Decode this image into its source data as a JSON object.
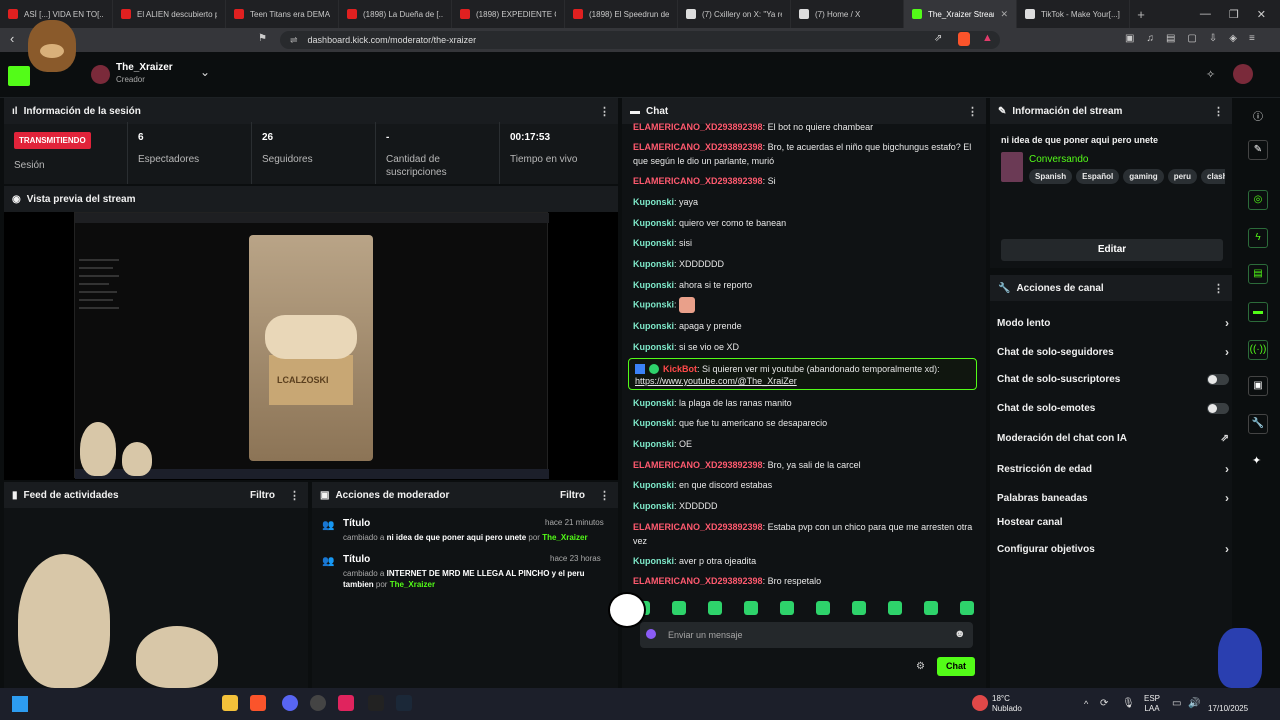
{
  "browser": {
    "tabs": [
      {
        "label": "ASÍ [...] VIDA EN TO[...]",
        "color": "#e02020"
      },
      {
        "label": "El ALIEN descubierto p[...]",
        "color": "#e02020"
      },
      {
        "label": "Teen Titans era DEMAS[...]",
        "color": "#e02020"
      },
      {
        "label": "(1898) La Dueña de [...]",
        "color": "#e02020"
      },
      {
        "label": "(1898) EXPEDIENTE CA[...]",
        "color": "#e02020"
      },
      {
        "label": "(1898) El Speedrun del[...]",
        "color": "#e02020"
      },
      {
        "label": "(7) Cxillery on X: \"Ya re[...]",
        "color": "#dddddd"
      },
      {
        "label": "(7) Home / X",
        "color": "#dddddd"
      },
      {
        "label": "The_Xraizer Stream",
        "color": "#53fc18",
        "active": true
      },
      {
        "label": "TikTok - Make Your[...]",
        "color": "#dddddd"
      }
    ],
    "url": "dashboard.kick.com/moderator/the-xraizer"
  },
  "header": {
    "channel_name": "The_Xraizer",
    "role": "Creador"
  },
  "session": {
    "title": "Información de la sesión",
    "live_badge": "TRANSMITIENDO",
    "session_label": "Sesión",
    "stats": [
      {
        "value": "6",
        "label": "Espectadores"
      },
      {
        "value": "26",
        "label": "Seguidores"
      },
      {
        "value": "-",
        "label": "Cantidad de suscripciones"
      },
      {
        "value": "00:17:53",
        "label": "Tiempo en vivo"
      }
    ]
  },
  "preview": {
    "title": "Vista previa del stream",
    "box_text": "LCALZOSKI"
  },
  "activity": {
    "title": "Feed de actividades",
    "filter": "Filtro"
  },
  "modactions": {
    "title": "Acciones de moderador",
    "filter": "Filtro",
    "items": [
      {
        "heading": "Título",
        "time": "hace 21 minutos",
        "prefix": "cambiado a",
        "value": "ni idea de que poner aqui pero unete",
        "by": "por",
        "user": "The_Xraizer"
      },
      {
        "heading": "Título",
        "time": "hace 23 horas",
        "prefix": "cambiado a",
        "value": "INTERNET DE MRD ME LLEGA AL PINCHO y el peru tambien",
        "by": "por",
        "user": "The_Xraizer"
      }
    ]
  },
  "chat": {
    "title": "Chat",
    "messages": [
      {
        "user": "ELAMERICANO_XD293892398",
        "text": "El bot no quiere chambear"
      },
      {
        "user": "ELAMERICANO_XD293892398",
        "text": "Bro, te acuerdas el niño que bigchungus estafo? El que según le dio un parlante, murió"
      },
      {
        "user": "ELAMERICANO_XD293892398",
        "text": "Si"
      },
      {
        "user": "Kuponski",
        "text": "yaya"
      },
      {
        "user": "Kuponski",
        "text": "quiero ver como te banean"
      },
      {
        "user": "Kuponski",
        "text": "sisi"
      },
      {
        "user": "Kuponski",
        "text": "XDDDDDD"
      },
      {
        "user": "Kuponski",
        "text": "ahora si te reporto"
      },
      {
        "user": "Kuponski",
        "text": ""
      },
      {
        "user": "Kuponski",
        "text": "apaga y prende"
      },
      {
        "user": "Kuponski",
        "text": "si se vio oe XD"
      },
      {
        "user": "Kuponski",
        "text": "la plaga de las ranas manito"
      },
      {
        "user": "Kuponski",
        "text": "que fue tu americano se desaparecio"
      },
      {
        "user": "Kuponski",
        "text": "OE"
      },
      {
        "user": "ELAMERICANO_XD293892398",
        "text": "Bro, ya sali de la carcel"
      },
      {
        "user": "Kuponski",
        "text": "en que discord estabas"
      },
      {
        "user": "Kuponski",
        "text": "XDDDDD"
      },
      {
        "user": "ELAMERICANO_XD293892398",
        "text": "Estaba pvp con un chico para que me arresten otra vez"
      },
      {
        "user": "Kuponski",
        "text": "aver p otra ojeadita"
      },
      {
        "user": "ELAMERICANO_XD293892398",
        "text": "Bro respetalo"
      }
    ],
    "bot": {
      "user": "KickBot",
      "text": "Si quieren ver mi youtube (abandonado temporalmente xd):",
      "link": "https://www.youtube.com/@The_XraiZer"
    },
    "input_placeholder": "Enviar un mensaje",
    "send_label": "Chat"
  },
  "stream_info": {
    "title": "Información del stream",
    "stream_title": "ni idea de que poner aqui pero unete",
    "category": "Conversando",
    "tags": [
      "Spanish",
      "Español",
      "gaming",
      "peru",
      "clash"
    ],
    "edit_label": "Editar"
  },
  "channel_actions": {
    "title": "Acciones de canal",
    "items": [
      {
        "label": "Modo lento",
        "kind": "chevron"
      },
      {
        "label": "Chat de solo-seguidores",
        "kind": "chevron"
      },
      {
        "label": "Chat de solo-suscriptores",
        "kind": "toggle"
      },
      {
        "label": "Chat de solo-emotes",
        "kind": "toggle"
      },
      {
        "label": "Moderación del chat con IA",
        "kind": "external"
      },
      {
        "label": "Restricción de edad",
        "kind": "chevron"
      },
      {
        "label": "Palabras baneadas",
        "kind": "chevron"
      },
      {
        "label": "Hostear canal",
        "kind": "none"
      },
      {
        "label": "Configurar objetivos",
        "kind": "chevron"
      }
    ]
  },
  "taskbar": {
    "weather_temp": "18°C",
    "weather_desc": "Nublado",
    "lang_top": "ESP",
    "lang_bottom": "LAA",
    "date": "17/10/2025"
  },
  "colors": {
    "kick_green": "#53fc18",
    "live_red": "#e1233a",
    "username_red": "#ff5a6f",
    "username_teal": "#7ee8c9"
  }
}
